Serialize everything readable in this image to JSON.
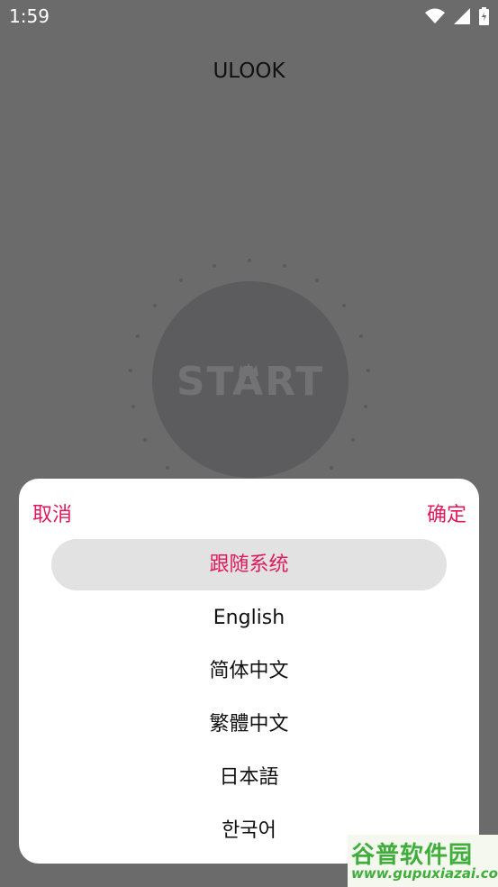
{
  "status_bar": {
    "time": "1:59"
  },
  "app": {
    "title": "ULOOK"
  },
  "start_button": {
    "label": "START"
  },
  "dialog": {
    "cancel_label": "取消",
    "confirm_label": "确定",
    "options": [
      {
        "label": "跟随系统",
        "selected": true
      },
      {
        "label": "English",
        "selected": false
      },
      {
        "label": "简体中文",
        "selected": false
      },
      {
        "label": "繁體中文",
        "selected": false
      },
      {
        "label": "日本語",
        "selected": false
      },
      {
        "label": "한국어",
        "selected": false
      }
    ]
  },
  "watermark": {
    "name": "谷普软件园",
    "url": "www.gupuxiazai.com"
  },
  "colors": {
    "accent": "#e0185c",
    "overlay": "#6b6b6b",
    "selected_bg": "#e2e2e2"
  }
}
